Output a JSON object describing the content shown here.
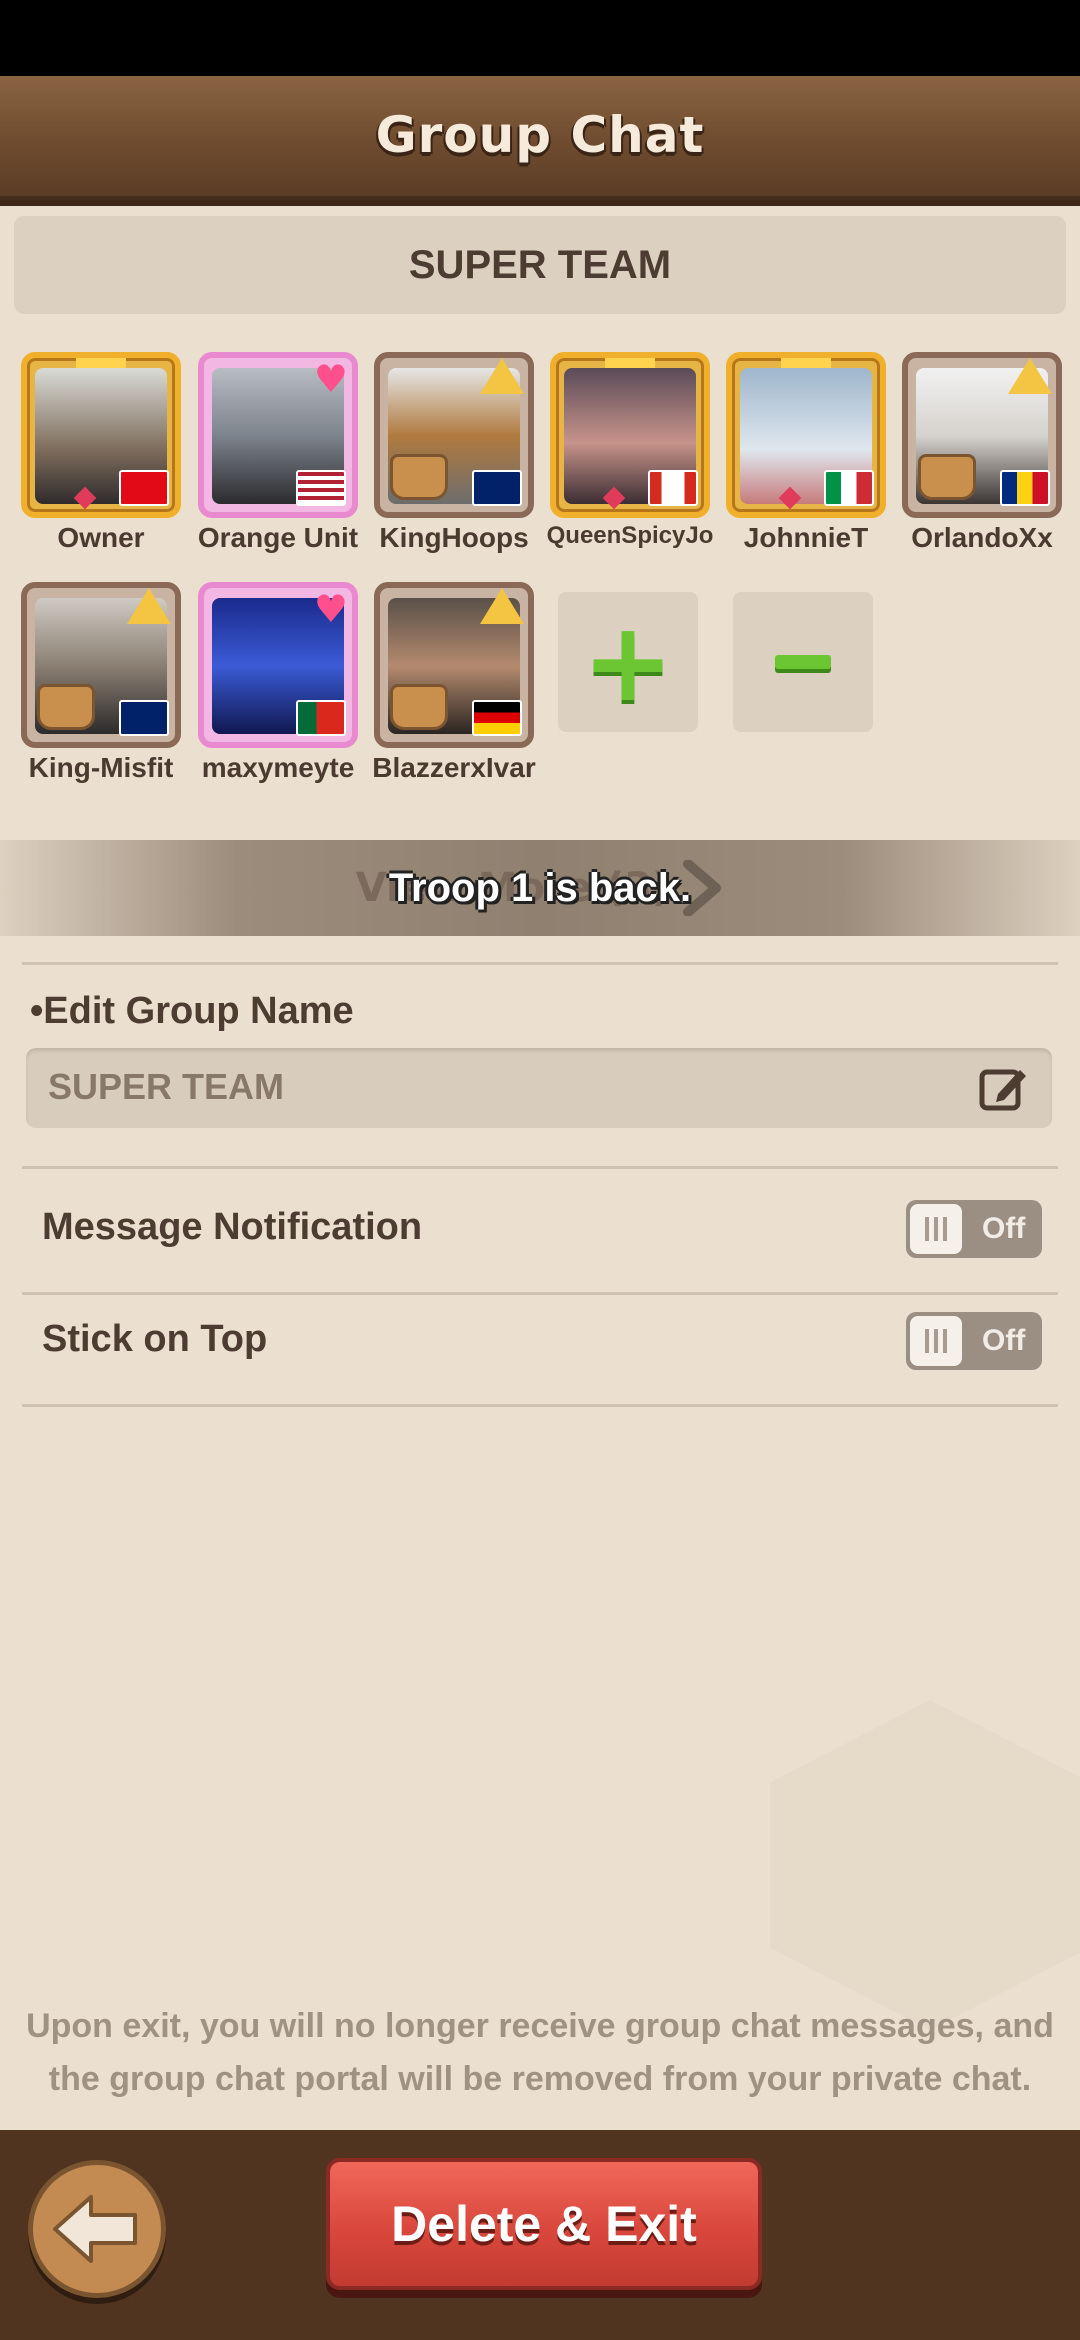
{
  "header": {
    "title": "Group Chat"
  },
  "team": {
    "banner_name": "SUPER TEAM"
  },
  "members": [
    {
      "name": "Owner",
      "frame": "gold",
      "flag": "tr"
    },
    {
      "name": "Orange Unit",
      "frame": "pink",
      "flag": "us"
    },
    {
      "name": "KingHoops",
      "frame": "wood",
      "flag": "gb"
    },
    {
      "name": "QueenSpicyJo",
      "frame": "gold",
      "flag": "ca"
    },
    {
      "name": "JohnnieT",
      "frame": "gold",
      "flag": "it"
    },
    {
      "name": "OrlandoXx",
      "frame": "wood",
      "flag": "ro"
    },
    {
      "name": "King-Misfit",
      "frame": "wood",
      "flag": "gb"
    },
    {
      "name": "maxymeyte",
      "frame": "pink",
      "flag": "pt"
    },
    {
      "name": "BlazzerxIvar",
      "frame": "wood",
      "flag": "de"
    }
  ],
  "member_actions": {
    "add_icon": "plus-icon",
    "remove_icon": "minus-icon"
  },
  "view_more": {
    "label": "View More (3)"
  },
  "toast": {
    "text": "Troop 1 is back."
  },
  "edit_group": {
    "label": "•Edit Group Name",
    "value": "SUPER TEAM",
    "icon": "edit-icon"
  },
  "settings": {
    "message_notification": {
      "label": "Message Notification",
      "state": "Off"
    },
    "stick_on_top": {
      "label": "Stick on Top",
      "state": "Off"
    }
  },
  "exit_note": {
    "line1": "Upon exit, you will no longer receive group chat messages, and",
    "line2": "the group chat portal will be removed from your private chat."
  },
  "footer": {
    "back_icon": "arrow-left-icon",
    "delete_exit_label": "Delete & Exit"
  },
  "colors": {
    "background": "#ebdfd0",
    "header": "#6e4b2f",
    "accent_green": "#6bc631",
    "danger_red": "#d9473c"
  }
}
